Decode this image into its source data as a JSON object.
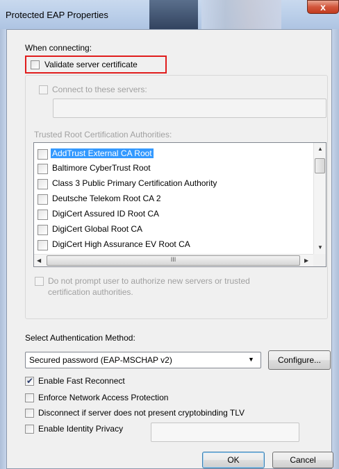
{
  "window": {
    "title": "Protected EAP Properties",
    "close_glyph": "x"
  },
  "section_when_connecting": "When connecting:",
  "validate_cert": {
    "label": "Validate server certificate",
    "checked": false
  },
  "connect_servers": {
    "label": "Connect to these servers:",
    "checked": false,
    "value": ""
  },
  "trusted_root_label": "Trusted Root Certification Authorities:",
  "trusted_roots": [
    {
      "label": "AddTrust External CA Root",
      "checked": false,
      "selected": true
    },
    {
      "label": "Baltimore CyberTrust Root",
      "checked": false,
      "selected": false
    },
    {
      "label": "Class 3 Public Primary Certification Authority",
      "checked": false,
      "selected": false
    },
    {
      "label": "Deutsche Telekom Root CA 2",
      "checked": false,
      "selected": false
    },
    {
      "label": "DigiCert Assured ID Root CA",
      "checked": false,
      "selected": false
    },
    {
      "label": "DigiCert Global Root CA",
      "checked": false,
      "selected": false
    },
    {
      "label": "DigiCert High Assurance EV Root CA",
      "checked": false,
      "selected": false
    }
  ],
  "scroll": {
    "h_thumb_glyph": "III"
  },
  "no_prompt": {
    "label_line1": "Do not prompt user to authorize new servers or trusted",
    "label_line2": "certification authorities.",
    "checked": false
  },
  "auth_method_label": "Select Authentication Method:",
  "auth_method": {
    "selected": "Secured password (EAP-MSCHAP v2)"
  },
  "configure_button": "Configure...",
  "options": [
    {
      "label": "Enable Fast Reconnect",
      "checked": true
    },
    {
      "label": "Enforce Network Access Protection",
      "checked": false
    },
    {
      "label": "Disconnect if server does not present cryptobinding TLV",
      "checked": false
    },
    {
      "label": "Enable Identity Privacy",
      "checked": false
    }
  ],
  "identity_privacy_value": "",
  "ok_button": "OK",
  "cancel_button": "Cancel",
  "colors": {
    "highlight_border": "#e01c1c",
    "selection": "#3399ff",
    "close_button": "#c23b1f"
  }
}
